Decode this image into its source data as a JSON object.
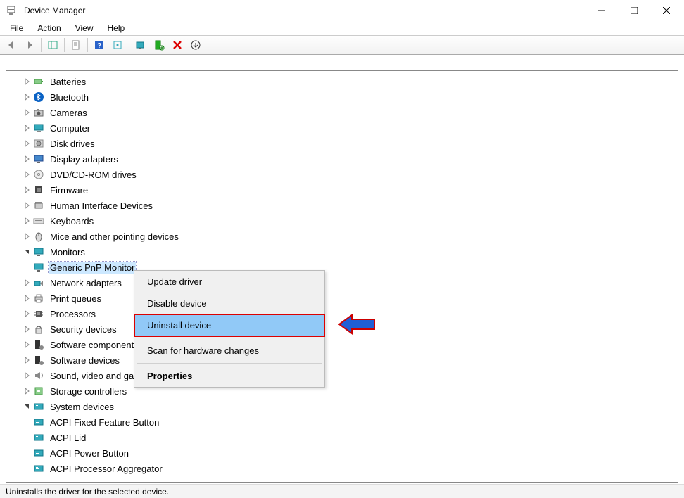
{
  "title": "Device Manager",
  "menubar": [
    "File",
    "Action",
    "View",
    "Help"
  ],
  "tree": [
    {
      "label": "Batteries",
      "icon": "battery",
      "ex": ">"
    },
    {
      "label": "Bluetooth",
      "icon": "bluetooth",
      "ex": ">"
    },
    {
      "label": "Cameras",
      "icon": "camera",
      "ex": ">"
    },
    {
      "label": "Computer",
      "icon": "computer",
      "ex": ">"
    },
    {
      "label": "Disk drives",
      "icon": "disk",
      "ex": ">"
    },
    {
      "label": "Display adapters",
      "icon": "display",
      "ex": ">"
    },
    {
      "label": "DVD/CD-ROM drives",
      "icon": "cd",
      "ex": ">"
    },
    {
      "label": "Firmware",
      "icon": "chip",
      "ex": ">"
    },
    {
      "label": "Human Interface Devices",
      "icon": "hid",
      "ex": ">"
    },
    {
      "label": "Keyboards",
      "icon": "keyboard",
      "ex": ">"
    },
    {
      "label": "Mice and other pointing devices",
      "icon": "mouse",
      "ex": ">"
    },
    {
      "label": "Monitors",
      "icon": "monitor",
      "ex": "v",
      "children": [
        {
          "label": "Generic PnP Monitor",
          "icon": "monitor",
          "selected": true
        }
      ]
    },
    {
      "label": "Network adapters",
      "icon": "network",
      "ex": ">"
    },
    {
      "label": "Print queues",
      "icon": "print",
      "ex": ">"
    },
    {
      "label": "Processors",
      "icon": "cpu",
      "ex": ">"
    },
    {
      "label": "Security devices",
      "icon": "security",
      "ex": ">"
    },
    {
      "label": "Software components",
      "icon": "sw",
      "ex": ">"
    },
    {
      "label": "Software devices",
      "icon": "sw",
      "ex": ">"
    },
    {
      "label": "Sound, video and game controllers",
      "icon": "sound",
      "ex": ">"
    },
    {
      "label": "Storage controllers",
      "icon": "storage",
      "ex": ">"
    },
    {
      "label": "System devices",
      "icon": "system",
      "ex": "v",
      "children": [
        {
          "label": "ACPI Fixed Feature Button",
          "icon": "system"
        },
        {
          "label": "ACPI Lid",
          "icon": "system"
        },
        {
          "label": "ACPI Power Button",
          "icon": "system"
        },
        {
          "label": "ACPI Processor Aggregator",
          "icon": "system"
        }
      ]
    }
  ],
  "context_menu": [
    {
      "label": "Update driver"
    },
    {
      "label": "Disable device"
    },
    {
      "label": "Uninstall device",
      "highlight": true
    },
    {
      "sep": true
    },
    {
      "label": "Scan for hardware changes"
    },
    {
      "sep": true
    },
    {
      "label": "Properties",
      "bold": true
    }
  ],
  "statusbar": "Uninstalls the driver for the selected device."
}
